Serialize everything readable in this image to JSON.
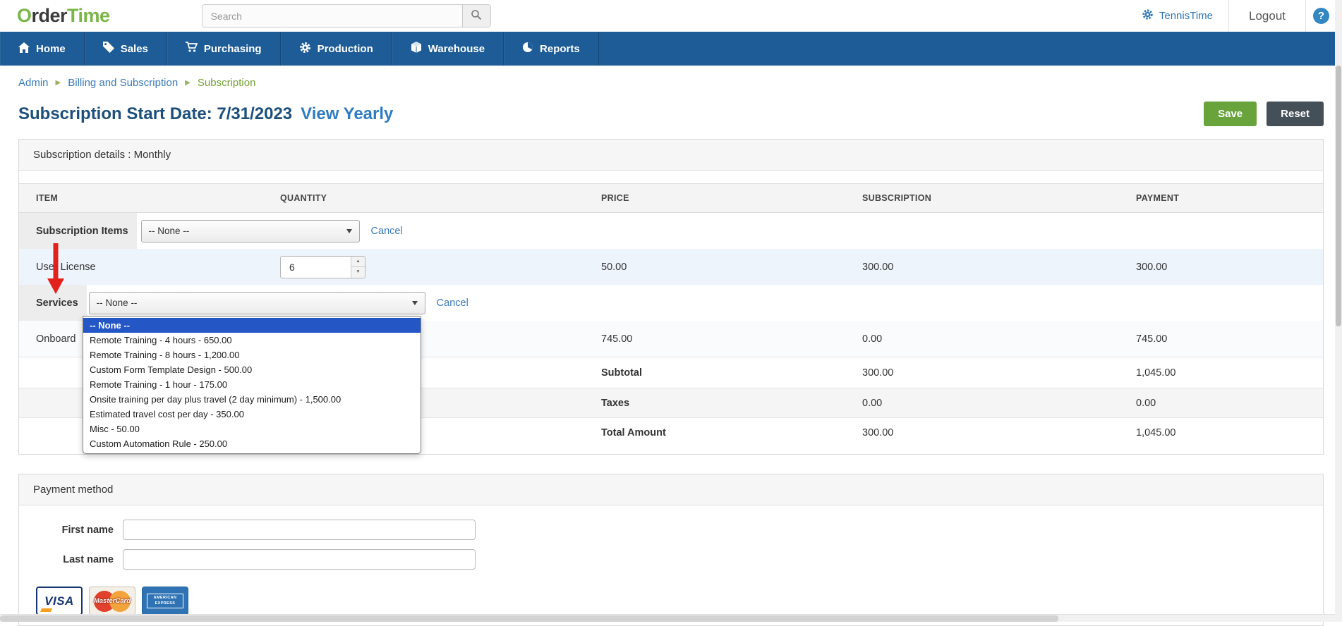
{
  "header": {
    "logo": {
      "o": "O",
      "rder": "rder",
      "time": "Time"
    },
    "search": {
      "placeholder": "Search"
    },
    "account_label": "TennisTime",
    "logout_label": "Logout",
    "help_label": "?"
  },
  "nav": [
    {
      "label": "Home"
    },
    {
      "label": "Sales"
    },
    {
      "label": "Purchasing"
    },
    {
      "label": "Production"
    },
    {
      "label": "Warehouse"
    },
    {
      "label": "Reports"
    }
  ],
  "breadcrumb": {
    "items": [
      "Admin",
      "Billing and Subscription",
      "Subscription"
    ]
  },
  "page": {
    "title": "Subscription Start Date: 7/31/2023",
    "view_toggle": "View Yearly",
    "save_label": "Save",
    "reset_label": "Reset"
  },
  "details": {
    "panel_title": "Subscription details : Monthly",
    "columns": [
      "ITEM",
      "QUANTITY",
      "PRICE",
      "SUBSCRIPTION",
      "PAYMENT"
    ],
    "subscription_items": {
      "label": "Subscription Items",
      "select_value": "-- None --",
      "cancel_label": "Cancel"
    },
    "user_license": {
      "label": "User License",
      "quantity": "6",
      "price": "50.00",
      "subscription": "300.00",
      "payment": "300.00"
    },
    "services": {
      "label": "Services",
      "select_value": "-- None --",
      "cancel_label": "Cancel"
    },
    "services_options": [
      "-- None --",
      "Remote Training - 4 hours - 650.00",
      "Remote Training - 8 hours - 1,200.00",
      "Custom Form Template Design - 500.00",
      "Remote Training - 1 hour - 175.00",
      "Onsite training per day plus travel (2 day minimum) - 1,500.00",
      "Estimated travel cost per day - 350.00",
      "Misc - 50.00",
      "Custom Automation Rule - 250.00"
    ],
    "onboarding": {
      "label": "Onboard",
      "price": "745.00",
      "subscription": "0.00",
      "payment": "745.00"
    },
    "summary": {
      "subtotal": {
        "label": "Subtotal",
        "subscription": "300.00",
        "payment": "1,045.00"
      },
      "taxes": {
        "label": "Taxes",
        "subscription": "0.00",
        "payment": "0.00"
      },
      "total": {
        "label": "Total Amount",
        "subscription": "300.00",
        "payment": "1,045.00"
      }
    }
  },
  "payment_method": {
    "panel_title": "Payment method",
    "first_name_label": "First name",
    "last_name_label": "Last name",
    "first_name_value": "",
    "last_name_value": "",
    "cards": [
      {
        "name": "visa",
        "text": "VISA"
      },
      {
        "name": "mastercard",
        "text": "MasterCard"
      },
      {
        "name": "amex",
        "text": "AMERICAN EXPRESS"
      }
    ]
  },
  "colors": {
    "navbar_blue": "#1d5c96",
    "brand_green": "#7ab648",
    "link_blue": "#3a7ab9",
    "title_navy": "#1c4f7c",
    "save_green": "#69a33b",
    "reset_slate": "#454f58",
    "selected_option_blue": "#2456c6",
    "annotation_arrow_red": "#e3201b",
    "row_highlight_blue": "#eef4fc"
  }
}
